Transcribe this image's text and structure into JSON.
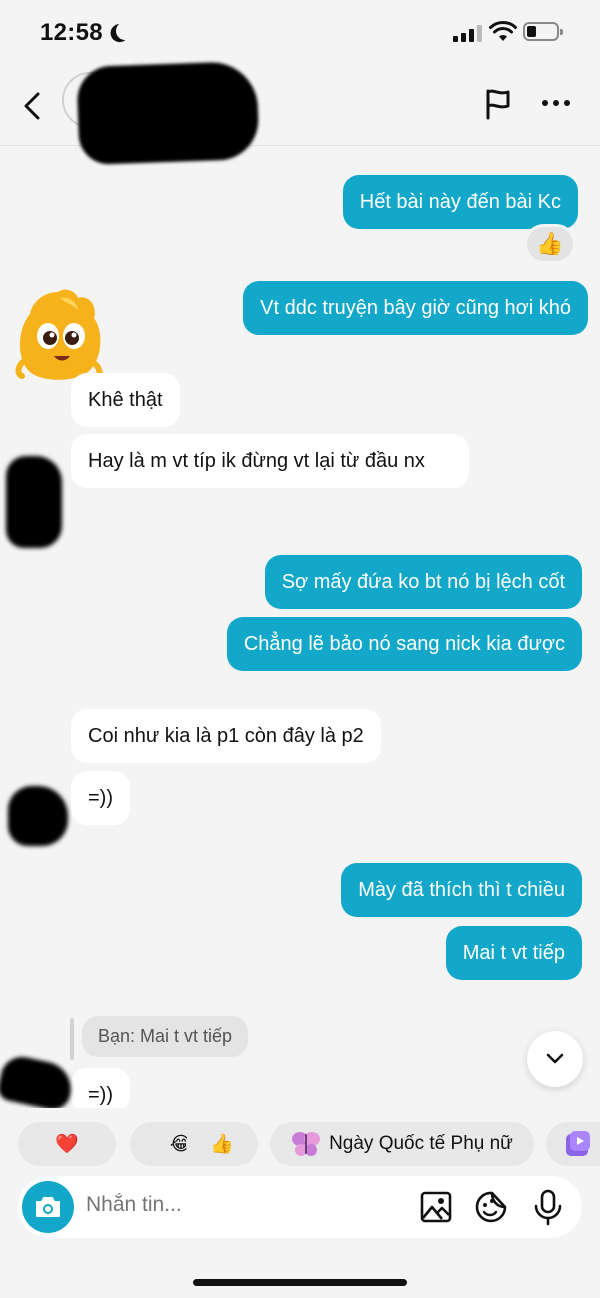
{
  "status": {
    "time": "12:58"
  },
  "header": {
    "contact_name": ""
  },
  "messages": [
    {
      "id": "m1",
      "side": "out",
      "text": "Hết bài này đến bài Kc",
      "reaction": "👍"
    },
    {
      "id": "m2",
      "side": "out",
      "text": "Vt ddc truyện bây giờ cũng hơi khó"
    },
    {
      "id": "m3",
      "side": "in",
      "text": "Khê thật"
    },
    {
      "id": "m4",
      "side": "in",
      "text": "Hay là m vt típ ik đừng vt lại từ đầu nx"
    },
    {
      "id": "m5",
      "side": "out",
      "text": "Sợ mấy đứa ko bt nó bị lệch cốt"
    },
    {
      "id": "m6",
      "side": "out",
      "text": "Chẳng lẽ bảo nó sang nick kia được"
    },
    {
      "id": "m7",
      "side": "in",
      "text": "Coi như kia là p1 còn đây là p2"
    },
    {
      "id": "m8",
      "side": "in",
      "text": "=))"
    },
    {
      "id": "m9",
      "side": "out",
      "text": "Mày đã thích thì t chiều"
    },
    {
      "id": "m10",
      "side": "out",
      "text": "Mai t vt tiếp"
    },
    {
      "id": "m11",
      "side": "in",
      "text": "=))",
      "reply_to": "Bạn: Mai t vt tiếp"
    }
  ],
  "quick_replies": [
    {
      "label": "❤️",
      "icon": "heart-emoji"
    },
    {
      "label": "😂",
      "icon": "laughing-emoji"
    },
    {
      "label": "👍",
      "icon": "thumbs-up-emoji"
    },
    {
      "label": "Ngày Quốc tế Phụ nữ",
      "icon": "butterfly-sticker-icon"
    },
    {
      "label": "",
      "icon": "video-sticker-icon"
    }
  ],
  "composer": {
    "placeholder": "Nhắn tin..."
  },
  "icons": [
    "back-chevron-icon",
    "flag-icon",
    "more-icon",
    "camera-icon",
    "image-icon",
    "sticker-icon",
    "microphone-icon",
    "chevron-down-icon"
  ],
  "colors": {
    "outgoing_bubble": "#13a7c9",
    "incoming_bubble": "#ffffff",
    "background": "#f4f4f4"
  }
}
